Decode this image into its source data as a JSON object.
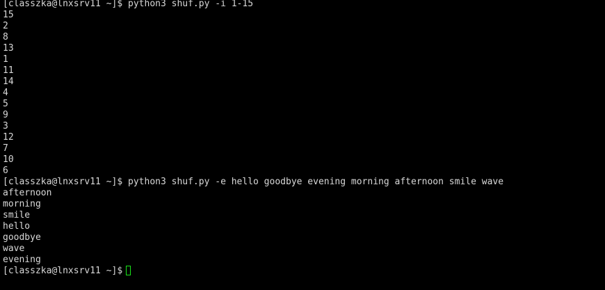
{
  "terminal": {
    "prompt": "[classzka@lnxsrv11 ~]$",
    "cursor_color": "#19e619",
    "lines": [
      "[classzka@lnxsrv11 ~]$ python3 shuf.py -i 1-15",
      "15",
      "2",
      "8",
      "13",
      "1",
      "11",
      "14",
      "4",
      "5",
      "9",
      "3",
      "12",
      "7",
      "10",
      "6",
      "[classzka@lnxsrv11 ~]$ python3 shuf.py -e hello goodbye evening morning afternoon smile wave",
      "afternoon",
      "morning",
      "smile",
      "hello",
      "goodbye",
      "wave",
      "evening"
    ]
  }
}
